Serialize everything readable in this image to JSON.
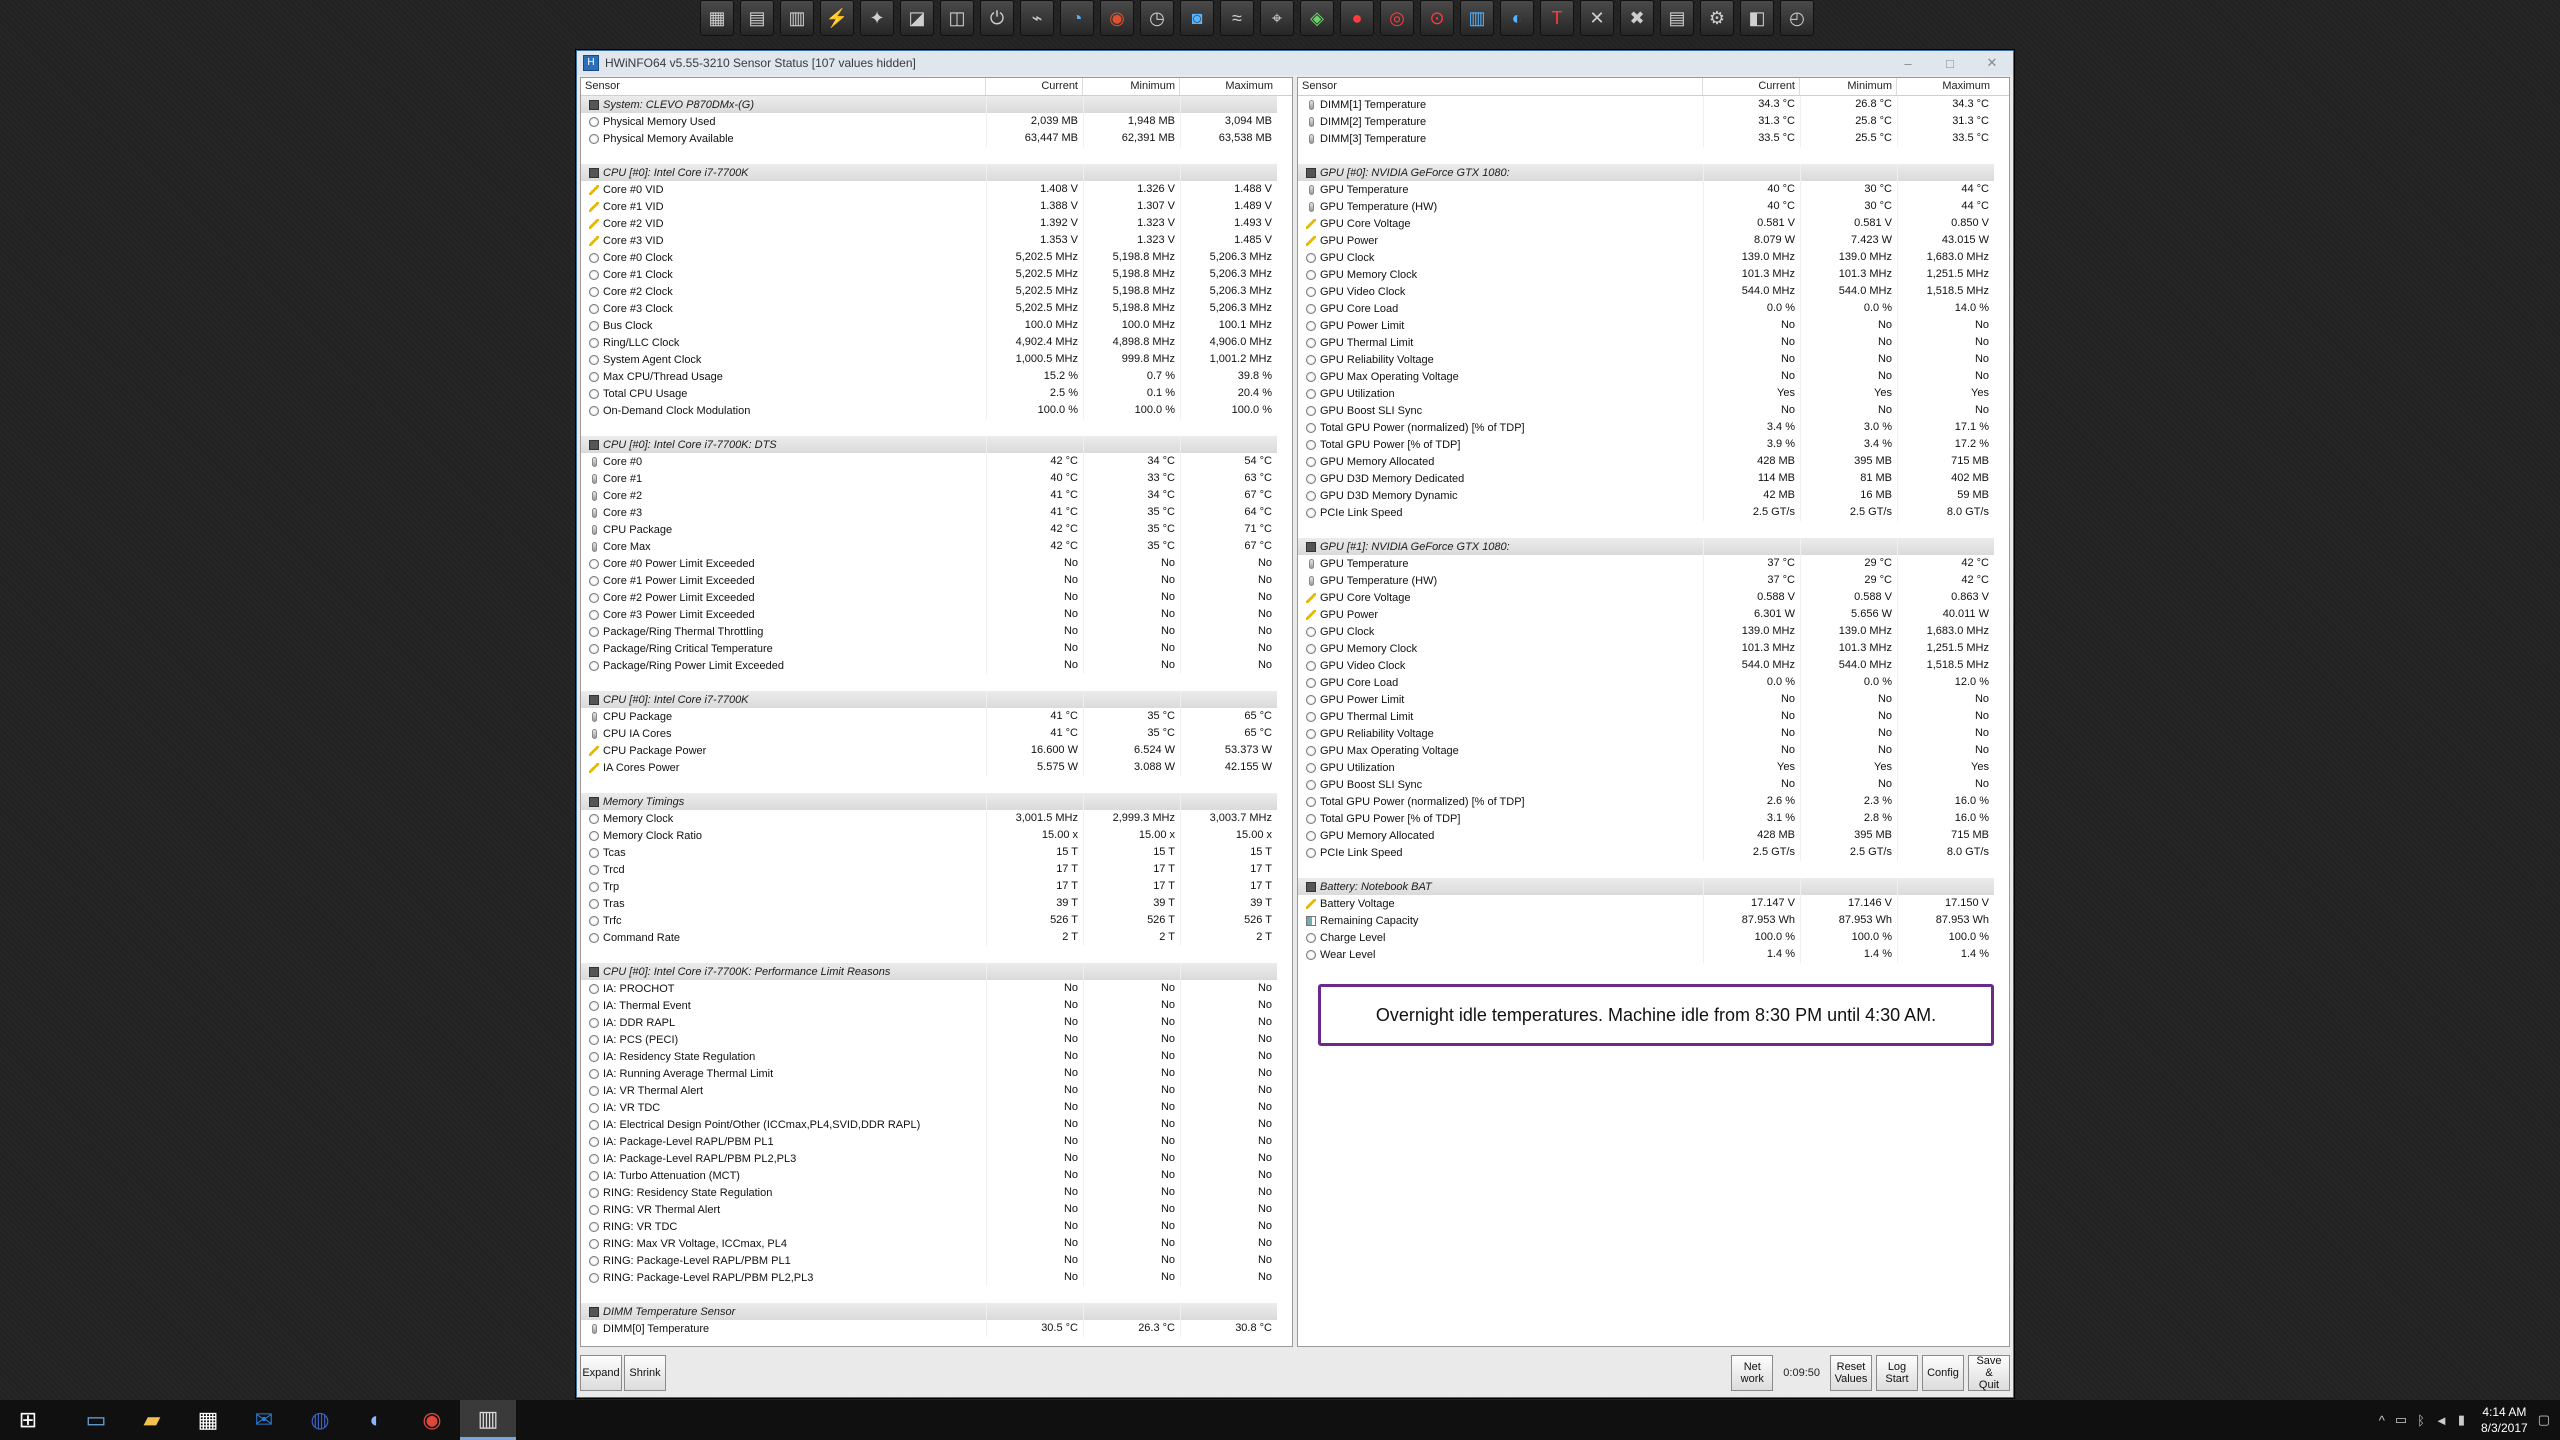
{
  "toolbar_icons": [
    "hwmonitor-icon",
    "gpu-z-icon",
    "ram-icon",
    "cpuz-icon",
    "bench-icon",
    "chart-icon",
    "disk-icon",
    "toggle-icon",
    "usb-icon",
    "gauge-icon",
    "record-icon",
    "clock-icon",
    "cam-icon",
    "stress-icon",
    "3dmark-icon",
    "nvidia-icon",
    "red-icon",
    "ring-icon",
    "target-icon",
    "bars-icon",
    "speed-icon",
    "t-icon",
    "x-icon",
    "cross-icon",
    "memo-icon",
    "gear-icon",
    "gamepad-icon",
    "stopwatch-icon"
  ],
  "window": {
    "title": "HWiNFO64 v5.55-3210 Sensor Status [107 values hidden]",
    "controls": {
      "minimize": "–",
      "maximize": "□",
      "close": "✕"
    }
  },
  "headers": {
    "sensor": "Sensor",
    "current": "Current",
    "minimum": "Minimum",
    "maximum": "Maximum"
  },
  "left_rows": [
    {
      "type": "group",
      "name": "System: CLEVO P870DMx-(G)"
    },
    {
      "icon": "gauge",
      "name": "Physical Memory Used",
      "cur": "2,039 MB",
      "min": "1,948 MB",
      "max": "3,094 MB"
    },
    {
      "icon": "gauge",
      "name": "Physical Memory Available",
      "cur": "63,447 MB",
      "min": "62,391 MB",
      "max": "63,538 MB"
    },
    {
      "type": "blank"
    },
    {
      "type": "group",
      "name": "CPU [#0]: Intel Core i7-7700K"
    },
    {
      "icon": "volt",
      "name": "Core #0 VID",
      "cur": "1.408 V",
      "min": "1.326 V",
      "max": "1.488 V"
    },
    {
      "icon": "volt",
      "name": "Core #1 VID",
      "cur": "1.388 V",
      "min": "1.307 V",
      "max": "1.489 V"
    },
    {
      "icon": "volt",
      "name": "Core #2 VID",
      "cur": "1.392 V",
      "min": "1.323 V",
      "max": "1.493 V"
    },
    {
      "icon": "volt",
      "name": "Core #3 VID",
      "cur": "1.353 V",
      "min": "1.323 V",
      "max": "1.485 V"
    },
    {
      "icon": "clock",
      "name": "Core #0 Clock",
      "cur": "5,202.5 MHz",
      "min": "5,198.8 MHz",
      "max": "5,206.3 MHz"
    },
    {
      "icon": "clock",
      "name": "Core #1 Clock",
      "cur": "5,202.5 MHz",
      "min": "5,198.8 MHz",
      "max": "5,206.3 MHz"
    },
    {
      "icon": "clock",
      "name": "Core #2 Clock",
      "cur": "5,202.5 MHz",
      "min": "5,198.8 MHz",
      "max": "5,206.3 MHz"
    },
    {
      "icon": "clock",
      "name": "Core #3 Clock",
      "cur": "5,202.5 MHz",
      "min": "5,198.8 MHz",
      "max": "5,206.3 MHz"
    },
    {
      "icon": "clock",
      "name": "Bus Clock",
      "cur": "100.0 MHz",
      "min": "100.0 MHz",
      "max": "100.1 MHz"
    },
    {
      "icon": "clock",
      "name": "Ring/LLC Clock",
      "cur": "4,902.4 MHz",
      "min": "4,898.8 MHz",
      "max": "4,906.0 MHz"
    },
    {
      "icon": "clock",
      "name": "System Agent Clock",
      "cur": "1,000.5 MHz",
      "min": "999.8 MHz",
      "max": "1,001.2 MHz"
    },
    {
      "icon": "gauge",
      "name": "Max CPU/Thread Usage",
      "cur": "15.2 %",
      "min": "0.7 %",
      "max": "39.8 %"
    },
    {
      "icon": "gauge",
      "name": "Total CPU Usage",
      "cur": "2.5 %",
      "min": "0.1 %",
      "max": "20.4 %"
    },
    {
      "icon": "gauge",
      "name": "On-Demand Clock Modulation",
      "cur": "100.0 %",
      "min": "100.0 %",
      "max": "100.0 %"
    },
    {
      "type": "blank"
    },
    {
      "type": "group",
      "name": "CPU [#0]: Intel Core i7-7700K: DTS"
    },
    {
      "icon": "therm",
      "name": "Core #0",
      "cur": "42 °C",
      "min": "34 °C",
      "max": "54 °C"
    },
    {
      "icon": "therm",
      "name": "Core #1",
      "cur": "40 °C",
      "min": "33 °C",
      "max": "63 °C"
    },
    {
      "icon": "therm",
      "name": "Core #2",
      "cur": "41 °C",
      "min": "34 °C",
      "max": "67 °C"
    },
    {
      "icon": "therm",
      "name": "Core #3",
      "cur": "41 °C",
      "min": "35 °C",
      "max": "64 °C"
    },
    {
      "icon": "therm",
      "name": "CPU Package",
      "cur": "42 °C",
      "min": "35 °C",
      "max": "71 °C"
    },
    {
      "icon": "therm",
      "name": "Core Max",
      "cur": "42 °C",
      "min": "35 °C",
      "max": "67 °C"
    },
    {
      "icon": "gauge",
      "name": "Core #0 Power Limit Exceeded",
      "cur": "No",
      "min": "No",
      "max": "No"
    },
    {
      "icon": "gauge",
      "name": "Core #1 Power Limit Exceeded",
      "cur": "No",
      "min": "No",
      "max": "No"
    },
    {
      "icon": "gauge",
      "name": "Core #2 Power Limit Exceeded",
      "cur": "No",
      "min": "No",
      "max": "No"
    },
    {
      "icon": "gauge",
      "name": "Core #3 Power Limit Exceeded",
      "cur": "No",
      "min": "No",
      "max": "No"
    },
    {
      "icon": "gauge",
      "name": "Package/Ring Thermal Throttling",
      "cur": "No",
      "min": "No",
      "max": "No"
    },
    {
      "icon": "gauge",
      "name": "Package/Ring Critical Temperature",
      "cur": "No",
      "min": "No",
      "max": "No"
    },
    {
      "icon": "gauge",
      "name": "Package/Ring Power Limit Exceeded",
      "cur": "No",
      "min": "No",
      "max": "No"
    },
    {
      "type": "blank"
    },
    {
      "type": "group",
      "name": "CPU [#0]: Intel Core i7-7700K"
    },
    {
      "icon": "therm",
      "name": "CPU Package",
      "cur": "41 °C",
      "min": "35 °C",
      "max": "65 °C"
    },
    {
      "icon": "therm",
      "name": "CPU IA Cores",
      "cur": "41 °C",
      "min": "35 °C",
      "max": "65 °C"
    },
    {
      "icon": "volt",
      "name": "CPU Package Power",
      "cur": "16.600 W",
      "min": "6.524 W",
      "max": "53.373 W"
    },
    {
      "icon": "volt",
      "name": "IA Cores Power",
      "cur": "5.575 W",
      "min": "3.088 W",
      "max": "42.155 W"
    },
    {
      "type": "blank"
    },
    {
      "type": "group",
      "name": "Memory Timings"
    },
    {
      "icon": "clock",
      "name": "Memory Clock",
      "cur": "3,001.5 MHz",
      "min": "2,999.3 MHz",
      "max": "3,003.7 MHz"
    },
    {
      "icon": "clock",
      "name": "Memory Clock Ratio",
      "cur": "15.00 x",
      "min": "15.00 x",
      "max": "15.00 x"
    },
    {
      "icon": "clock",
      "name": "Tcas",
      "cur": "15 T",
      "min": "15 T",
      "max": "15 T"
    },
    {
      "icon": "clock",
      "name": "Trcd",
      "cur": "17 T",
      "min": "17 T",
      "max": "17 T"
    },
    {
      "icon": "clock",
      "name": "Trp",
      "cur": "17 T",
      "min": "17 T",
      "max": "17 T"
    },
    {
      "icon": "clock",
      "name": "Tras",
      "cur": "39 T",
      "min": "39 T",
      "max": "39 T"
    },
    {
      "icon": "clock",
      "name": "Trfc",
      "cur": "526 T",
      "min": "526 T",
      "max": "526 T"
    },
    {
      "icon": "clock",
      "name": "Command Rate",
      "cur": "2 T",
      "min": "2 T",
      "max": "2 T"
    },
    {
      "type": "blank"
    },
    {
      "type": "group",
      "name": "CPU [#0]: Intel Core i7-7700K: Performance Limit Reasons"
    },
    {
      "icon": "gauge",
      "name": "IA: PROCHOT",
      "cur": "No",
      "min": "No",
      "max": "No"
    },
    {
      "icon": "gauge",
      "name": "IA: Thermal Event",
      "cur": "No",
      "min": "No",
      "max": "No"
    },
    {
      "icon": "gauge",
      "name": "IA: DDR RAPL",
      "cur": "No",
      "min": "No",
      "max": "No"
    },
    {
      "icon": "gauge",
      "name": "IA: PCS (PECI)",
      "cur": "No",
      "min": "No",
      "max": "No"
    },
    {
      "icon": "gauge",
      "name": "IA: Residency State Regulation",
      "cur": "No",
      "min": "No",
      "max": "No"
    },
    {
      "icon": "gauge",
      "name": "IA: Running Average Thermal Limit",
      "cur": "No",
      "min": "No",
      "max": "No"
    },
    {
      "icon": "gauge",
      "name": "IA: VR Thermal Alert",
      "cur": "No",
      "min": "No",
      "max": "No"
    },
    {
      "icon": "gauge",
      "name": "IA: VR TDC",
      "cur": "No",
      "min": "No",
      "max": "No"
    },
    {
      "icon": "gauge",
      "name": "IA: Electrical Design Point/Other (ICCmax,PL4,SVID,DDR RAPL)",
      "cur": "No",
      "min": "No",
      "max": "No"
    },
    {
      "icon": "gauge",
      "name": "IA: Package-Level RAPL/PBM PL1",
      "cur": "No",
      "min": "No",
      "max": "No"
    },
    {
      "icon": "gauge",
      "name": "IA: Package-Level RAPL/PBM PL2,PL3",
      "cur": "No",
      "min": "No",
      "max": "No"
    },
    {
      "icon": "gauge",
      "name": "IA: Turbo Attenuation (MCT)",
      "cur": "No",
      "min": "No",
      "max": "No"
    },
    {
      "icon": "gauge",
      "name": "RING: Residency State Regulation",
      "cur": "No",
      "min": "No",
      "max": "No"
    },
    {
      "icon": "gauge",
      "name": "RING: VR Thermal Alert",
      "cur": "No",
      "min": "No",
      "max": "No"
    },
    {
      "icon": "gauge",
      "name": "RING: VR TDC",
      "cur": "No",
      "min": "No",
      "max": "No"
    },
    {
      "icon": "gauge",
      "name": "RING: Max VR Voltage, ICCmax, PL4",
      "cur": "No",
      "min": "No",
      "max": "No"
    },
    {
      "icon": "gauge",
      "name": "RING: Package-Level RAPL/PBM PL1",
      "cur": "No",
      "min": "No",
      "max": "No"
    },
    {
      "icon": "gauge",
      "name": "RING: Package-Level RAPL/PBM PL2,PL3",
      "cur": "No",
      "min": "No",
      "max": "No"
    },
    {
      "type": "blank"
    },
    {
      "type": "group",
      "name": "DIMM Temperature Sensor"
    },
    {
      "icon": "therm",
      "name": "DIMM[0] Temperature",
      "cur": "30.5 °C",
      "min": "26.3 °C",
      "max": "30.8 °C"
    }
  ],
  "right_rows": [
    {
      "icon": "therm",
      "name": "DIMM[1] Temperature",
      "cur": "34.3 °C",
      "min": "26.8 °C",
      "max": "34.3 °C"
    },
    {
      "icon": "therm",
      "name": "DIMM[2] Temperature",
      "cur": "31.3 °C",
      "min": "25.8 °C",
      "max": "31.3 °C"
    },
    {
      "icon": "therm",
      "name": "DIMM[3] Temperature",
      "cur": "33.5 °C",
      "min": "25.5 °C",
      "max": "33.5 °C"
    },
    {
      "type": "blank"
    },
    {
      "type": "group",
      "name": "GPU [#0]: NVIDIA GeForce GTX 1080:"
    },
    {
      "icon": "therm",
      "name": "GPU Temperature",
      "cur": "40 °C",
      "min": "30 °C",
      "max": "44 °C"
    },
    {
      "icon": "therm",
      "name": "GPU Temperature (HW)",
      "cur": "40 °C",
      "min": "30 °C",
      "max": "44 °C"
    },
    {
      "icon": "volt",
      "name": "GPU Core Voltage",
      "cur": "0.581 V",
      "min": "0.581 V",
      "max": "0.850 V"
    },
    {
      "icon": "volt",
      "name": "GPU Power",
      "cur": "8.079 W",
      "min": "7.423 W",
      "max": "43.015 W"
    },
    {
      "icon": "clock",
      "name": "GPU Clock",
      "cur": "139.0 MHz",
      "min": "139.0 MHz",
      "max": "1,683.0 MHz"
    },
    {
      "icon": "clock",
      "name": "GPU Memory Clock",
      "cur": "101.3 MHz",
      "min": "101.3 MHz",
      "max": "1,251.5 MHz"
    },
    {
      "icon": "clock",
      "name": "GPU Video Clock",
      "cur": "544.0 MHz",
      "min": "544.0 MHz",
      "max": "1,518.5 MHz"
    },
    {
      "icon": "gauge",
      "name": "GPU Core Load",
      "cur": "0.0 %",
      "min": "0.0 %",
      "max": "14.0 %"
    },
    {
      "icon": "gauge",
      "name": "GPU Power Limit",
      "cur": "No",
      "min": "No",
      "max": "No"
    },
    {
      "icon": "gauge",
      "name": "GPU Thermal Limit",
      "cur": "No",
      "min": "No",
      "max": "No"
    },
    {
      "icon": "gauge",
      "name": "GPU Reliability Voltage",
      "cur": "No",
      "min": "No",
      "max": "No"
    },
    {
      "icon": "gauge",
      "name": "GPU Max Operating Voltage",
      "cur": "No",
      "min": "No",
      "max": "No"
    },
    {
      "icon": "gauge",
      "name": "GPU Utilization",
      "cur": "Yes",
      "min": "Yes",
      "max": "Yes"
    },
    {
      "icon": "gauge",
      "name": "GPU Boost SLI Sync",
      "cur": "No",
      "min": "No",
      "max": "No"
    },
    {
      "icon": "gauge",
      "name": "Total GPU Power (normalized) [% of TDP]",
      "cur": "3.4 %",
      "min": "3.0 %",
      "max": "17.1 %"
    },
    {
      "icon": "gauge",
      "name": "Total GPU Power [% of TDP]",
      "cur": "3.9 %",
      "min": "3.4 %",
      "max": "17.2 %"
    },
    {
      "icon": "gauge",
      "name": "GPU Memory Allocated",
      "cur": "428 MB",
      "min": "395 MB",
      "max": "715 MB"
    },
    {
      "icon": "gauge",
      "name": "GPU D3D Memory Dedicated",
      "cur": "114 MB",
      "min": "81 MB",
      "max": "402 MB"
    },
    {
      "icon": "gauge",
      "name": "GPU D3D Memory Dynamic",
      "cur": "42 MB",
      "min": "16 MB",
      "max": "59 MB"
    },
    {
      "icon": "gauge",
      "name": "PCIe Link Speed",
      "cur": "2.5 GT/s",
      "min": "2.5 GT/s",
      "max": "8.0 GT/s"
    },
    {
      "type": "blank"
    },
    {
      "type": "group",
      "name": "GPU [#1]: NVIDIA GeForce GTX 1080:"
    },
    {
      "icon": "therm",
      "name": "GPU Temperature",
      "cur": "37 °C",
      "min": "29 °C",
      "max": "42 °C"
    },
    {
      "icon": "therm",
      "name": "GPU Temperature (HW)",
      "cur": "37 °C",
      "min": "29 °C",
      "max": "42 °C"
    },
    {
      "icon": "volt",
      "name": "GPU Core Voltage",
      "cur": "0.588 V",
      "min": "0.588 V",
      "max": "0.863 V"
    },
    {
      "icon": "volt",
      "name": "GPU Power",
      "cur": "6.301 W",
      "min": "5.656 W",
      "max": "40.011 W"
    },
    {
      "icon": "clock",
      "name": "GPU Clock",
      "cur": "139.0 MHz",
      "min": "139.0 MHz",
      "max": "1,683.0 MHz"
    },
    {
      "icon": "clock",
      "name": "GPU Memory Clock",
      "cur": "101.3 MHz",
      "min": "101.3 MHz",
      "max": "1,251.5 MHz"
    },
    {
      "icon": "clock",
      "name": "GPU Video Clock",
      "cur": "544.0 MHz",
      "min": "544.0 MHz",
      "max": "1,518.5 MHz"
    },
    {
      "icon": "gauge",
      "name": "GPU Core Load",
      "cur": "0.0 %",
      "min": "0.0 %",
      "max": "12.0 %"
    },
    {
      "icon": "gauge",
      "name": "GPU Power Limit",
      "cur": "No",
      "min": "No",
      "max": "No"
    },
    {
      "icon": "gauge",
      "name": "GPU Thermal Limit",
      "cur": "No",
      "min": "No",
      "max": "No"
    },
    {
      "icon": "gauge",
      "name": "GPU Reliability Voltage",
      "cur": "No",
      "min": "No",
      "max": "No"
    },
    {
      "icon": "gauge",
      "name": "GPU Max Operating Voltage",
      "cur": "No",
      "min": "No",
      "max": "No"
    },
    {
      "icon": "gauge",
      "name": "GPU Utilization",
      "cur": "Yes",
      "min": "Yes",
      "max": "Yes"
    },
    {
      "icon": "gauge",
      "name": "GPU Boost SLI Sync",
      "cur": "No",
      "min": "No",
      "max": "No"
    },
    {
      "icon": "gauge",
      "name": "Total GPU Power (normalized) [% of TDP]",
      "cur": "2.6 %",
      "min": "2.3 %",
      "max": "16.0 %"
    },
    {
      "icon": "gauge",
      "name": "Total GPU Power [% of TDP]",
      "cur": "3.1 %",
      "min": "2.8 %",
      "max": "16.0 %"
    },
    {
      "icon": "gauge",
      "name": "GPU Memory Allocated",
      "cur": "428 MB",
      "min": "395 MB",
      "max": "715 MB"
    },
    {
      "icon": "gauge",
      "name": "PCIe Link Speed",
      "cur": "2.5 GT/s",
      "min": "2.5 GT/s",
      "max": "8.0 GT/s"
    },
    {
      "type": "blank"
    },
    {
      "type": "group",
      "name": "Battery: Notebook BAT"
    },
    {
      "icon": "volt",
      "name": "Battery Voltage",
      "cur": "17.147 V",
      "min": "17.146 V",
      "max": "17.150 V"
    },
    {
      "icon": "battery",
      "name": "Remaining Capacity",
      "cur": "87.953 Wh",
      "min": "87.953 Wh",
      "max": "87.953 Wh"
    },
    {
      "icon": "gauge",
      "name": "Charge Level",
      "cur": "100.0 %",
      "min": "100.0 %",
      "max": "100.0 %"
    },
    {
      "icon": "gauge",
      "name": "Wear Level",
      "cur": "1.4 %",
      "min": "1.4 %",
      "max": "1.4 %"
    }
  ],
  "annotation": "Overnight idle temperatures. Machine idle from 8:30 PM until 4:30 AM.",
  "buttons": {
    "expand": "Expand",
    "shrink": "Shrink",
    "network": "Net\nwork",
    "timer": "0:09:50",
    "reset": "Reset\nValues",
    "log": "Log\nStart",
    "config": "Config",
    "save_quit": "Save &\nQuit"
  },
  "taskbar": {
    "items": [
      "windows-start-icon",
      "desktop-icon",
      "file-explorer-icon",
      "store-icon",
      "outlook-icon",
      "browser-icon",
      "firefox-icon",
      "chrome-icon",
      "hwinfo-taskbar-icon"
    ],
    "time": "4:14 AM",
    "date": "8/3/2017"
  }
}
